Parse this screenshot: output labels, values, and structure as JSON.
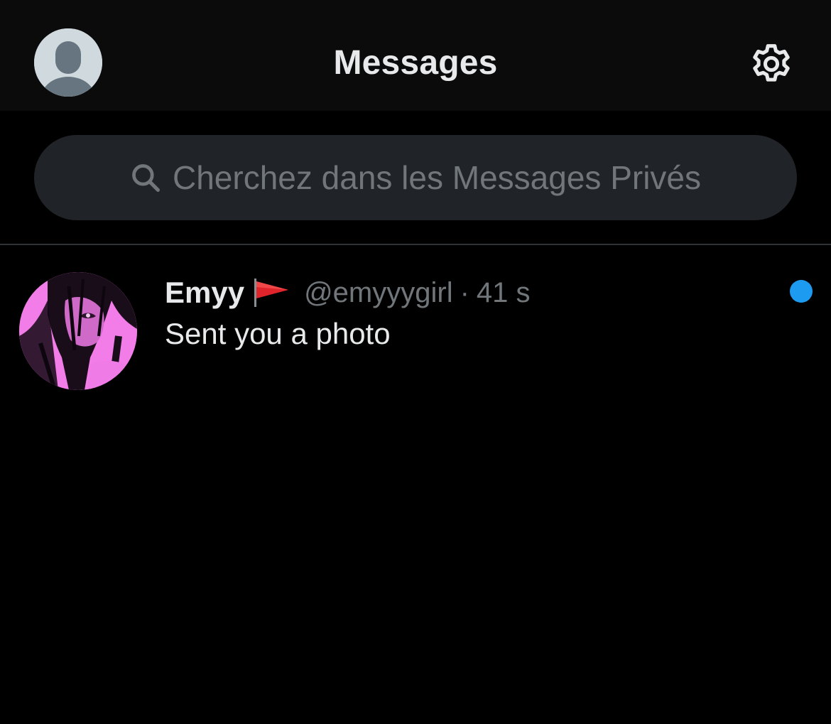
{
  "header": {
    "title": "Messages",
    "avatar_icon": "default-profile-icon",
    "settings_icon": "gear-icon"
  },
  "search": {
    "placeholder": "Cherchez dans les Messages Privés",
    "icon": "search-icon"
  },
  "conversations": [
    {
      "display_name": "Emyy",
      "name_emoji_icon": "red-flag-icon",
      "handle": "@emyyygirl",
      "separator": "·",
      "timestamp": "41 s",
      "preview": "Sent you a photo",
      "unread": true
    }
  ],
  "colors": {
    "background": "#000000",
    "header_background": "#0b0b0b",
    "search_background": "#202327",
    "primary_text": "#e7e9ea",
    "secondary_text": "#71767b",
    "accent_blue": "#1d9bf0",
    "divider": "#2f3336",
    "avatar_pink": "#f27ce8"
  }
}
